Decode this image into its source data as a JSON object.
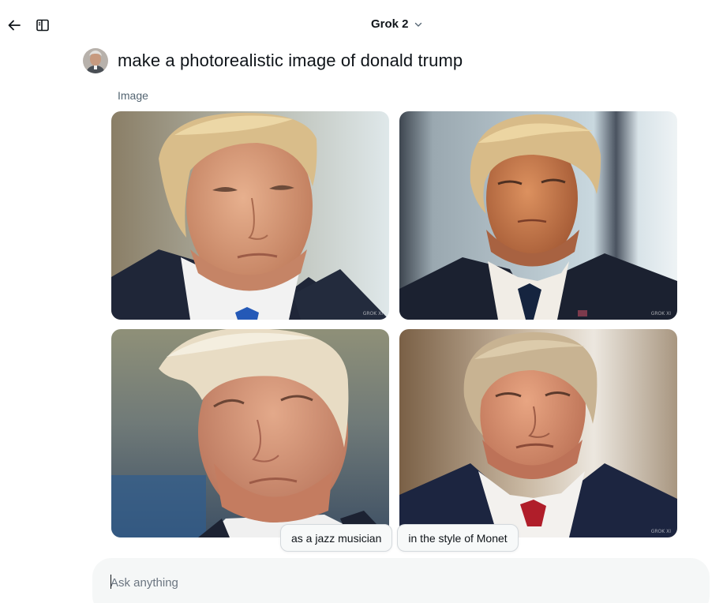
{
  "header": {
    "back_icon": "arrow-left-icon",
    "sidebar_icon": "sidebar-panel-icon",
    "model_label": "Grok 2",
    "model_chevron": "chevron-down-icon"
  },
  "conversation": {
    "prompt": "make a photorealistic image of donald trump",
    "section_label": "Image",
    "images": [
      {
        "watermark": "GROK XI"
      },
      {
        "watermark": "GROK XI"
      },
      {
        "watermark": ""
      },
      {
        "watermark": "GROK XI"
      }
    ]
  },
  "suggestions": [
    "as a jazz musician",
    "in the style of Monet"
  ],
  "composer": {
    "placeholder": "Ask anything"
  },
  "colors": {
    "text_primary": "#0f1419",
    "text_secondary": "#536471",
    "chip_border": "#d4d9dd",
    "input_bg": "#f5f7f7"
  }
}
